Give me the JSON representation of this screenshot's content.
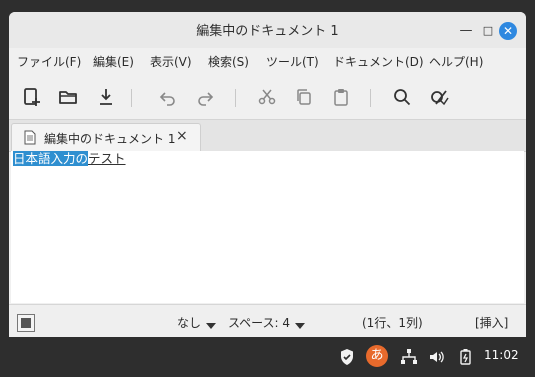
{
  "window": {
    "title": "編集中のドキュメント 1"
  },
  "menu": {
    "file": "ファイル(F)",
    "edit": "編集(E)",
    "view": "表示(V)",
    "search": "検索(S)",
    "tools": "ツール(T)",
    "documents": "ドキュメント(D)",
    "help": "ヘルプ(H)"
  },
  "toolbar": {
    "icons": [
      "new-document-icon",
      "open-folder-icon",
      "save-download-icon",
      "undo-icon",
      "redo-icon",
      "cut-icon",
      "copy-icon",
      "paste-icon",
      "search-icon",
      "spellcheck-icon"
    ]
  },
  "tab": {
    "label": "編集中のドキュメント 1",
    "close": "×"
  },
  "editor": {
    "selected_text": "日本語入力の",
    "preedit_text": "テスト"
  },
  "status": {
    "highlight_mode": "なし",
    "indent": "スペース: 4",
    "position": "(1行、1列)",
    "insert_mode": "[挿入]"
  },
  "panel": {
    "ime_label": "あ",
    "clock": "11:02",
    "icons": [
      "shield-icon",
      "input-method-icon",
      "network-icon",
      "volume-icon",
      "battery-icon"
    ]
  },
  "colors": {
    "selection": "#2f8fd0",
    "close_button": "#2e88e0",
    "ime": "#e86a2c",
    "panel": "#2e2e2e"
  }
}
